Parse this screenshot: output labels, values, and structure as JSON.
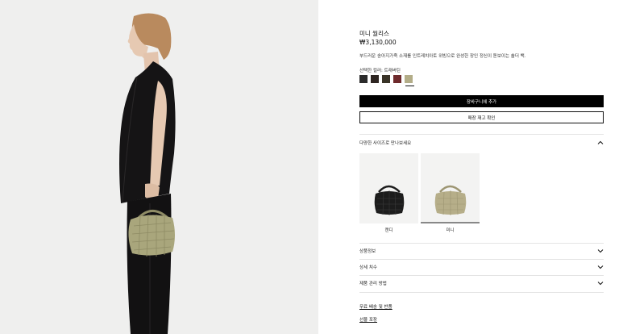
{
  "product": {
    "title": "미니 월리스",
    "price": "₩3,130,000",
    "description": "부드러운 송아지가죽 소재를 인트레치아토 위빙으로 완성한 장인 정신이 돋보이는 숄더 백.",
    "selected_color_label": "선택한 컬러: 트래버틴",
    "swatches": [
      {
        "name": "black",
        "color": "#2b2b2b"
      },
      {
        "name": "dark-brown",
        "color": "#2e2622"
      },
      {
        "name": "olive-brown",
        "color": "#3a3428"
      },
      {
        "name": "burgundy",
        "color": "#6e2a2c"
      },
      {
        "name": "travertine",
        "color": "#b3ad88"
      }
    ]
  },
  "actions": {
    "add_to_cart": "장바구니에 추가",
    "check_stock": "매장 재고 확인"
  },
  "sizes": {
    "heading": "다양한 사이즈로 만나보세요",
    "options": [
      {
        "label": "캔디",
        "bag_color": "#1c1c1c"
      },
      {
        "label": "미니",
        "bag_color": "#b6ae89"
      }
    ]
  },
  "accordion": {
    "details": "상품정보",
    "dimensions": "상세 치수",
    "care": "제품 관리 방법"
  },
  "links": {
    "shipping": "무료 배송 및 반품",
    "gift": "선물 포장"
  },
  "colors": {
    "photo_bg": "#efefee",
    "bag_green": "#a9a67c",
    "primary_button": "#000000"
  }
}
